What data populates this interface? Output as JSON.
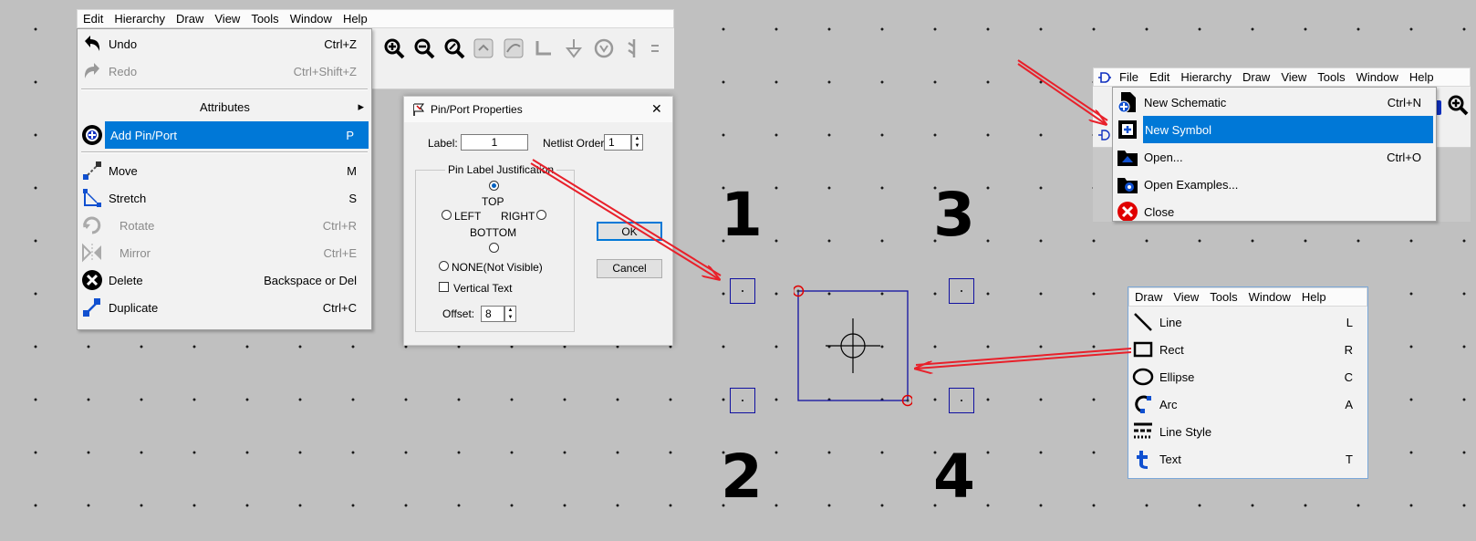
{
  "main_window": {
    "menubar": [
      "Edit",
      "Hierarchy",
      "Draw",
      "View",
      "Tools",
      "Window",
      "Help"
    ]
  },
  "edit_menu": {
    "items": [
      {
        "label": "Undo",
        "shortcut": "Ctrl+Z",
        "icon": "undo-icon",
        "disabled": false
      },
      {
        "label": "Redo",
        "shortcut": "Ctrl+Shift+Z",
        "icon": "redo-icon",
        "disabled": true
      },
      {
        "label": "Attributes",
        "shortcut": "",
        "icon": "",
        "submenu": true
      },
      {
        "label": "Add Pin/Port",
        "shortcut": "P",
        "icon": "add-pin-icon",
        "selected": true
      },
      {
        "label": "Move",
        "shortcut": "M",
        "icon": "move-icon"
      },
      {
        "label": "Stretch",
        "shortcut": "S",
        "icon": "stretch-icon"
      },
      {
        "label": "Rotate",
        "shortcut": "Ctrl+R",
        "icon": "rotate-icon",
        "disabled": true
      },
      {
        "label": "Mirror",
        "shortcut": "Ctrl+E",
        "icon": "mirror-icon",
        "disabled": true
      },
      {
        "label": "Delete",
        "shortcut": "Backspace or Del",
        "icon": "delete-icon"
      },
      {
        "label": "Duplicate",
        "shortcut": "Ctrl+C",
        "icon": "duplicate-icon"
      }
    ],
    "submenu_arrow": "▸"
  },
  "pin_dialog": {
    "title": "Pin/Port Properties",
    "close_glyph": "✕",
    "label_caption": "Label:",
    "label_value": "1",
    "netlist_caption": "Netlist Order:",
    "netlist_value": "1",
    "justification_title": "Pin Label Justification",
    "top": "TOP",
    "left": "LEFT",
    "right": "RIGHT",
    "bottom": "BOTTOM",
    "none": "NONE(Not Visible)",
    "vertical_text": "Vertical Text",
    "offset_caption": "Offset:",
    "offset_value": "8",
    "ok_label": "OK",
    "cancel_label": "Cancel"
  },
  "canvas": {
    "pin_labels": [
      "1",
      "2",
      "3",
      "4"
    ]
  },
  "file_window": {
    "menubar": [
      "File",
      "Edit",
      "Hierarchy",
      "Draw",
      "View",
      "Tools",
      "Window",
      "Help"
    ],
    "items": [
      {
        "label": "New Schematic",
        "shortcut": "Ctrl+N",
        "icon": "new-schematic-icon"
      },
      {
        "label": "New Symbol",
        "shortcut": "",
        "icon": "new-symbol-icon",
        "selected": true
      },
      {
        "label": "Open...",
        "shortcut": "Ctrl+O",
        "icon": "open-folder-icon"
      },
      {
        "label": "Open Examples...",
        "shortcut": "",
        "icon": "open-examples-icon"
      },
      {
        "label": "Close",
        "shortcut": "",
        "icon": "close-icon"
      }
    ]
  },
  "draw_window": {
    "menubar": [
      "Draw",
      "View",
      "Tools",
      "Window",
      "Help"
    ],
    "items": [
      {
        "label": "Line",
        "shortcut": "L",
        "icon": "line-icon"
      },
      {
        "label": "Rect",
        "shortcut": "R",
        "icon": "rect-icon"
      },
      {
        "label": "Ellipse",
        "shortcut": "C",
        "icon": "ellipse-icon"
      },
      {
        "label": "Arc",
        "shortcut": "A",
        "icon": "arc-icon"
      },
      {
        "label": "Line Style",
        "shortcut": "",
        "icon": "line-style-icon"
      },
      {
        "label": "Text",
        "shortcut": "T",
        "icon": "text-icon"
      }
    ]
  },
  "colors": {
    "selection": "#0078d7",
    "arrow": "#e8202a",
    "symbol_outline": "#1010a0"
  }
}
